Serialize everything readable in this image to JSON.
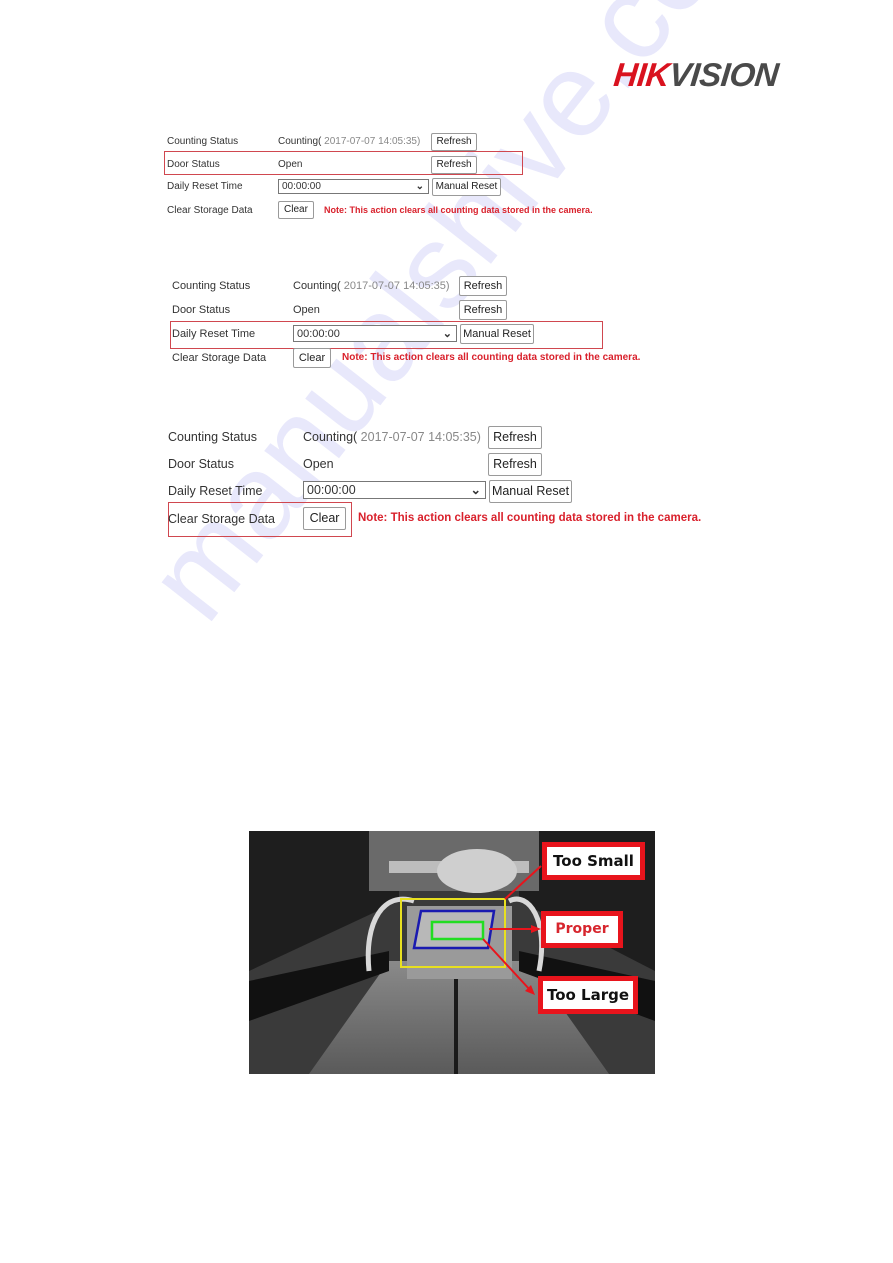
{
  "brand": {
    "logo_part1": "HIK",
    "logo_part2": "VISION"
  },
  "panels": [
    {
      "highlighted_row": "door_status",
      "counting_status": {
        "label": "Counting Status",
        "value": "Counting(",
        "timestamp": " 2017-07-07 14:05:35)",
        "button": "Refresh"
      },
      "door_status": {
        "label": "Door Status",
        "value": "Open",
        "button": "Refresh"
      },
      "daily_reset": {
        "label": "Daily Reset Time",
        "selected": "00:00:00",
        "button": "Manual Reset"
      },
      "clear_storage": {
        "label": "Clear Storage Data",
        "button": "Clear",
        "note": "Note: This action clears all counting data stored in the camera."
      }
    },
    {
      "highlighted_row": "daily_reset",
      "counting_status": {
        "label": "Counting Status",
        "value": "Counting(",
        "timestamp": " 2017-07-07 14:05:35)",
        "button": "Refresh"
      },
      "door_status": {
        "label": "Door Status",
        "value": "Open",
        "button": "Refresh"
      },
      "daily_reset": {
        "label": "Daily Reset Time",
        "selected": "00:00:00",
        "button": "Manual Reset"
      },
      "clear_storage": {
        "label": "Clear Storage Data",
        "button": "Clear",
        "note": "Note: This action clears all counting data stored in the camera."
      }
    },
    {
      "highlighted_row": "clear_storage",
      "counting_status": {
        "label": "Counting Status",
        "value": "Counting(",
        "timestamp": " 2017-07-07 14:05:35)",
        "button": "Refresh"
      },
      "door_status": {
        "label": "Door Status",
        "value": "Open",
        "button": "Refresh"
      },
      "daily_reset": {
        "label": "Daily Reset Time",
        "selected": "00:00:00",
        "button": "Manual Reset"
      },
      "clear_storage": {
        "label": "Clear Storage Data",
        "button": "Clear",
        "note": "Note: This action clears all counting data stored in the camera."
      }
    }
  ],
  "camera_figure": {
    "labels": {
      "too_small": "Too Small",
      "proper": "Proper",
      "too_large": "Too Large"
    },
    "colors": {
      "too_small_box": "#e8e020",
      "proper_box": "#1a1ab0",
      "too_large_box": "#22dd22",
      "callout": "#e8141c"
    }
  },
  "watermark": "manualshive.com",
  "colors": {
    "highlight_border": "#d0474f",
    "note_text": "#d9212c",
    "brand_red": "#d9121f"
  }
}
